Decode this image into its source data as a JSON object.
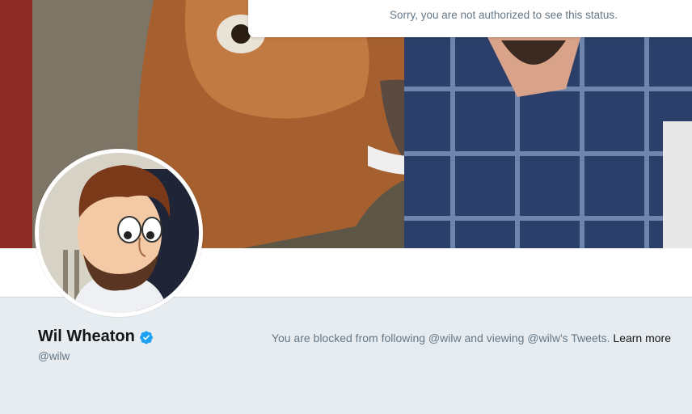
{
  "notice": {
    "text": "Sorry, you are not authorized to see this status."
  },
  "profile": {
    "display_name": "Wil Wheaton",
    "handle": "@wilw",
    "verified_icon": "verified-badge-icon",
    "verified_color": "#1da1f2"
  },
  "blocked": {
    "message": "You are blocked from following @wilw and viewing @wilw's Tweets.",
    "learn_more": "Learn more"
  },
  "colors": {
    "page_background": "#e6ecf0",
    "secondary_text": "#657786",
    "primary_text": "#14171a"
  }
}
